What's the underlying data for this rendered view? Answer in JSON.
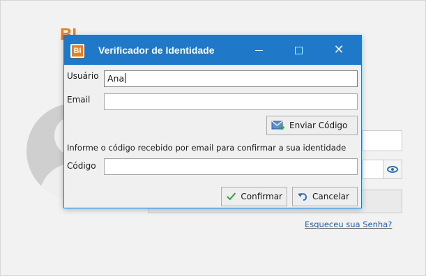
{
  "background": {
    "logo_text": "BI",
    "forgot_password_link": "Esqueceu sua Senha?"
  },
  "dialog": {
    "app_icon_text": "BI",
    "title": "Verificador de Identidade",
    "labels": {
      "usuario": "Usuário",
      "email": "Email",
      "info": "Informe o código recebido por email para confirmar a sua identidade",
      "codigo": "Código"
    },
    "fields": {
      "usuario_value": "Ana",
      "email_value": "",
      "codigo_value": ""
    },
    "buttons": {
      "send_code": "Enviar Código",
      "confirm": "Confirmar",
      "cancel": "Cancelar"
    }
  },
  "colors": {
    "titlebar": "#1f78c8",
    "brand_orange": "#f07b1f",
    "link": "#1a5fc2",
    "confirm_icon": "#3aa53a",
    "cancel_icon": "#2d6fb5"
  }
}
